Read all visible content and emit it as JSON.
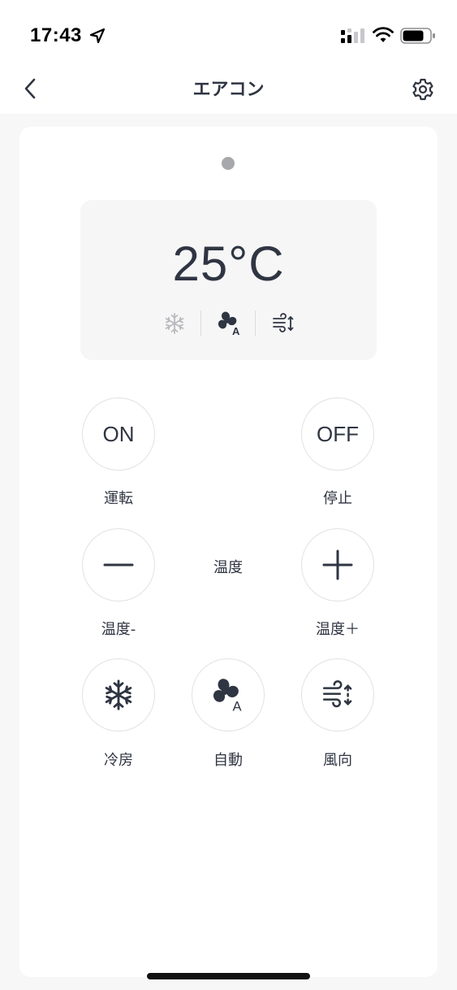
{
  "status_bar": {
    "time": "17:43",
    "icons": [
      "location-arrow-icon",
      "cellular-signal-icon",
      "wifi-icon",
      "battery-icon"
    ]
  },
  "nav": {
    "title": "エアコン",
    "back_icon": "chevron-left-icon",
    "settings_icon": "gear-icon"
  },
  "display": {
    "temperature": "25°C",
    "modes": [
      "snowflake-icon",
      "fan-auto-icon",
      "wind-direction-icon"
    ]
  },
  "controls": {
    "on": {
      "text": "ON",
      "label": "運転"
    },
    "off": {
      "text": "OFF",
      "label": "停止"
    },
    "temp_down": {
      "icon": "minus-icon",
      "label": "温度-"
    },
    "temp_center_label": "温度",
    "temp_up": {
      "icon": "plus-icon",
      "label": "温度＋"
    },
    "cool": {
      "icon": "snowflake-icon",
      "label": "冷房"
    },
    "auto": {
      "icon": "fan-auto-icon",
      "label": "自動"
    },
    "wind": {
      "icon": "wind-direction-icon",
      "label": "風向"
    }
  },
  "colors": {
    "text": "#2f3542",
    "background": "#f7f7f7",
    "card": "#ffffff",
    "panel": "#f6f6f7",
    "indicator": "#a6a8ac",
    "button_border": "#e2e2e5"
  }
}
